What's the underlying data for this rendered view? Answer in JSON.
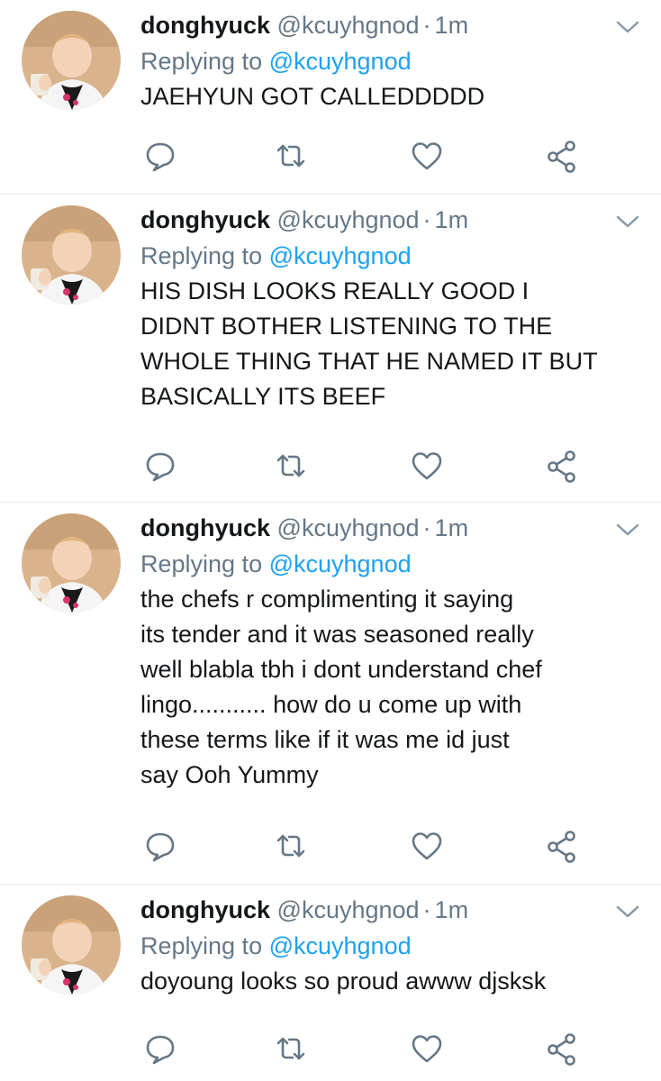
{
  "colors": {
    "text": "#14171a",
    "secondary": "#657786",
    "link": "#1da1f2",
    "divider": "#e1e8ed"
  },
  "icons": [
    "avatar-photo",
    "chevron-down-icon",
    "reply-icon",
    "retweet-icon",
    "like-icon",
    "share-icon"
  ],
  "tweets": [
    {
      "name": "donghyuck",
      "handle": "@kcuyhgnod",
      "separator": "·",
      "time": "1m",
      "replying_prefix": "Replying to ",
      "replying_handle": "@kcuyhgnod",
      "text": "JAEHYUN GOT CALLEDDDDD"
    },
    {
      "name": "donghyuck",
      "handle": "@kcuyhgnod",
      "separator": "·",
      "time": "1m",
      "replying_prefix": "Replying to ",
      "replying_handle": "@kcuyhgnod",
      "text": "HIS DISH LOOKS REALLY GOOD I\nDIDNT BOTHER LISTENING TO THE\nWHOLE THING THAT HE NAMED IT BUT\nBASICALLY ITS BEEF"
    },
    {
      "name": "donghyuck",
      "handle": "@kcuyhgnod",
      "separator": "·",
      "time": "1m",
      "replying_prefix": "Replying to ",
      "replying_handle": "@kcuyhgnod",
      "text": "the chefs r complimenting it saying\nits tender and it was seasoned really\nwell blabla tbh i dont understand chef\nlingo........... how do u come up with\nthese terms like if it was me id just\nsay Ooh Yummy"
    },
    {
      "name": "donghyuck",
      "handle": "@kcuyhgnod",
      "separator": "·",
      "time": "1m",
      "replying_prefix": "Replying to ",
      "replying_handle": "@kcuyhgnod",
      "text": "doyoung looks so proud awww djsksk"
    }
  ]
}
